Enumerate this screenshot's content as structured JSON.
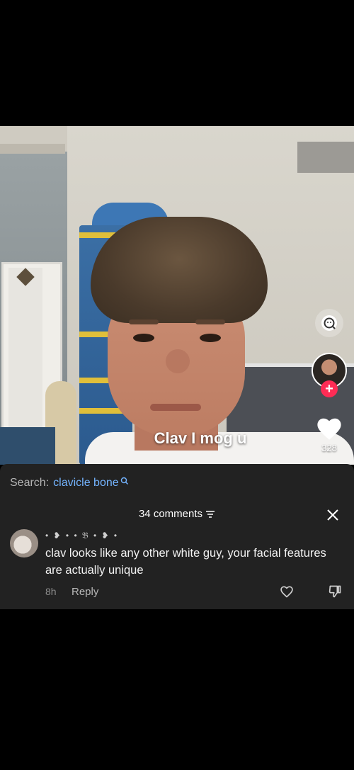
{
  "video": {
    "caption": "Clav I mog u",
    "like_count": "328"
  },
  "search_bar": {
    "prefix": "Search:",
    "term": "clavicle bone"
  },
  "comments_sheet": {
    "count_label": "34 comments"
  },
  "comment": {
    "username": "• ❥ • • 𝔅 • ❥ •",
    "text": "clav looks like any other white guy, your facial features are actually unique",
    "time": "8h",
    "reply_label": "Reply"
  },
  "colors": {
    "accent_search": "#74b4ff",
    "follow_button": "#fe2c55",
    "sheet_background": "#222222"
  },
  "icons": [
    "face-search-icon",
    "plus-icon",
    "heart-icon",
    "search-icon",
    "filter-icon",
    "close-icon",
    "heart-outline-icon",
    "dislike-icon"
  ]
}
